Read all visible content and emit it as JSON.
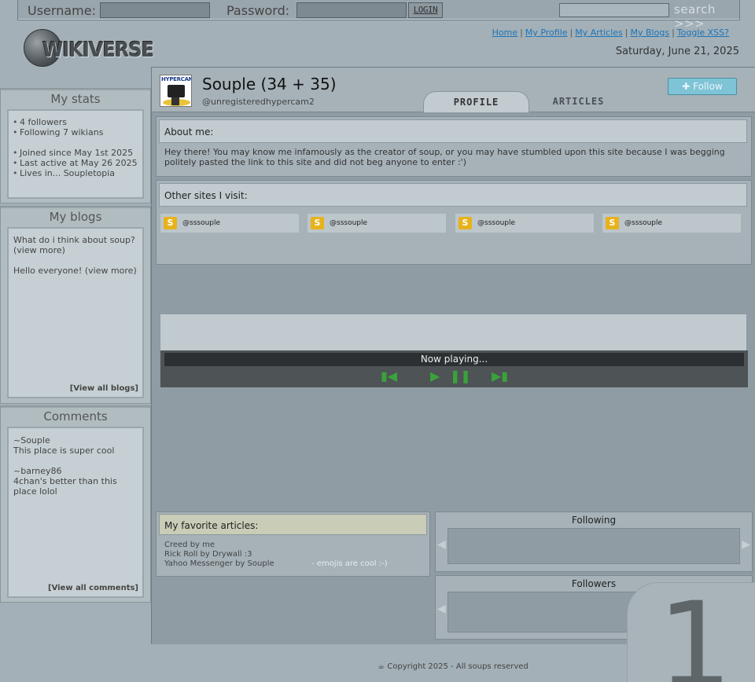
{
  "topbar": {
    "username_label": "Username:",
    "password_label": "Password:",
    "login_label": "LOGIN",
    "search_label": "search >>>"
  },
  "logo": {
    "text": "WIKIVERSE"
  },
  "nav": {
    "links": [
      "Home",
      "My Profile",
      "My Articles",
      "My Blogs",
      "Toggle XSS?"
    ],
    "link_color": "#1b74b8"
  },
  "date": "Saturday, June 21, 2025",
  "sidebar": {
    "stats": {
      "title": "My stats",
      "items_a": [
        "4 followers",
        "Following 7 wikians"
      ],
      "items_b": [
        "Joined since May 1st 2025",
        "Last active at May 26 2025",
        "Lives in... Soupletopia"
      ]
    },
    "blogs": {
      "title": "My blogs",
      "entries": [
        "What do i think about soup? (view more)",
        "Hello everyone! (view more)"
      ],
      "view_all": "[View all blogs]"
    },
    "comments": {
      "title": "Comments",
      "entries": [
        {
          "author": "~Souple",
          "text": "This place is super cool"
        },
        {
          "author": "~barney86",
          "text": "4chan's better than this place lolol"
        }
      ],
      "view_all": "[View all comments]"
    }
  },
  "profile": {
    "avatar_text": "HYPERCAM",
    "name": "Souple (34 + 35)",
    "handle": "@unregisteredhypercam2",
    "follow_label": "Follow",
    "follow_color": "#7fc3d6",
    "tabs": [
      "PROFILE",
      "ARTICLES"
    ]
  },
  "about": {
    "title": "About me:",
    "text": "Hey there! You may know me infamously as the creator of soup, or you may have stumbled upon this site because I was begging politely pasted the link to this site and did not beg anyone to enter :')"
  },
  "sites": {
    "title": "Other sites I visit:",
    "items": [
      "@sssouple",
      "@sssouple",
      "@sssouple",
      "@sssouple"
    ],
    "icon_color": "#e7b21c"
  },
  "player": {
    "now_playing": "Now playing...",
    "accent": "#3aa23a"
  },
  "favorites": {
    "title": "My favorite articles:",
    "items": [
      "Creed by me",
      "Rick Roll by Drywall :3",
      "Yahoo Messenger by Souple"
    ],
    "note": "- emojis are cool :-)"
  },
  "following": {
    "title": "Following"
  },
  "followers": {
    "title": "Followers"
  },
  "badge": {
    "number": "1"
  },
  "footer": "Copyright 2025 - All soups reserved"
}
